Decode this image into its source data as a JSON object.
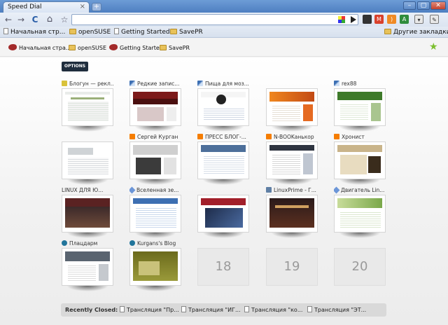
{
  "tab": {
    "title": "Speed Dial",
    "close": "×",
    "newtab": "+"
  },
  "window_controls": {
    "minimize": "–",
    "maximize": "▢",
    "close": "✕"
  },
  "nav": {
    "back": "←",
    "forward": "→",
    "reload": "C",
    "home": "⌂",
    "star": "☆"
  },
  "omnibox": {
    "value": ""
  },
  "bookmarks": [
    {
      "label": "Начальная стр...",
      "type": "page"
    },
    {
      "label": "openSUSE",
      "type": "folder"
    },
    {
      "label": "Getting Started",
      "type": "page"
    },
    {
      "label": "SavePR",
      "type": "folder"
    }
  ],
  "other_bookmarks": "Другие закладки",
  "speed_dial_bookmarks": [
    {
      "label": "Начальная стра...",
      "icon": "bird"
    },
    {
      "label": "openSUSE",
      "icon": "folder"
    },
    {
      "label": "Getting Started",
      "icon": "bird"
    },
    {
      "label": "SavePR",
      "icon": "folder"
    }
  ],
  "options_label": "OPTIONS",
  "dials": [
    {
      "label": "Блогун — рекл...",
      "icon": "sq"
    },
    {
      "label": "Редкие запис...",
      "icon": "pencil"
    },
    {
      "label": "Пища для моз...",
      "icon": "pencil"
    },
    {
      "label": "",
      "icon": ""
    },
    {
      "label": "rex88",
      "icon": "pencil"
    },
    {
      "label": "",
      "icon": ""
    },
    {
      "label": "Сергей Курган",
      "icon": "blogger"
    },
    {
      "label": "ПРЕСС БЛОГ-...",
      "icon": "blogger"
    },
    {
      "label": "N-BOOKанькор",
      "icon": "blogger"
    },
    {
      "label": "Хронист",
      "icon": "blogger"
    },
    {
      "label": "LINUX ДЛЯ Ю...",
      "icon": ""
    },
    {
      "label": "Вселенная зе...",
      "icon": "diamond"
    },
    {
      "label": "",
      "icon": ""
    },
    {
      "label": "LinuxPrime - Г...",
      "icon": "mon"
    },
    {
      "label": "Двигатель Lin...",
      "icon": "diamond"
    },
    {
      "label": "Плацдарм",
      "icon": "wp"
    },
    {
      "label": "Kurgans's Blog",
      "icon": "wp"
    }
  ],
  "empty_slots": [
    "18",
    "19",
    "20"
  ],
  "recently_closed": {
    "title": "Recently Closed:",
    "items": [
      "Трансляция \"Пр...",
      "Трансляция \"ИГ...",
      "Трансляция \"ко...",
      "Трансляция \"ЭТ..."
    ]
  },
  "colors": {
    "accent": "#1f2d3d",
    "tab_blue": "#4e7fc1",
    "blogger": "#f57d00",
    "wordpress": "#21759b"
  }
}
